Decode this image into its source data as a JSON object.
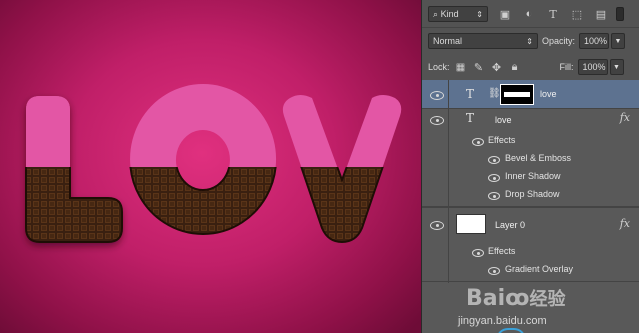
{
  "canvas": {
    "letters": [
      "L",
      "O",
      "V"
    ],
    "colors": {
      "pink": "#e356a5",
      "chocolate": "#3a2010",
      "chocolate_light": "#5a3418",
      "bg_center": "#e0307f",
      "bg_edge": "#6e0c37"
    }
  },
  "filter_bar": {
    "kind_label": "Kind",
    "icons": [
      "image-filter-icon",
      "adjustment-filter-icon",
      "type-filter-icon",
      "shape-filter-icon",
      "smart-object-filter-icon",
      "filter-toggle-icon"
    ]
  },
  "blend": {
    "mode": "Normal",
    "opacity_label": "Opacity:",
    "opacity_value": "100%"
  },
  "lock": {
    "label": "Lock:",
    "fill_label": "Fill:",
    "fill_value": "100%"
  },
  "layers": [
    {
      "name": "love",
      "type": "text-with-mask",
      "selected": true
    },
    {
      "name": "love",
      "type": "text",
      "fx": "fx",
      "effects_label": "Effects",
      "effects": [
        "Bevel & Emboss",
        "Inner Shadow",
        "Drop Shadow"
      ]
    },
    {
      "name": "Layer 0",
      "type": "pixel",
      "fx": "fx",
      "effects_label": "Effects",
      "effects": [
        "Gradient Overlay"
      ]
    }
  ],
  "watermark": {
    "brand": "Bai",
    "brand2": "经验",
    "url": "jingyan.baidu.com"
  }
}
